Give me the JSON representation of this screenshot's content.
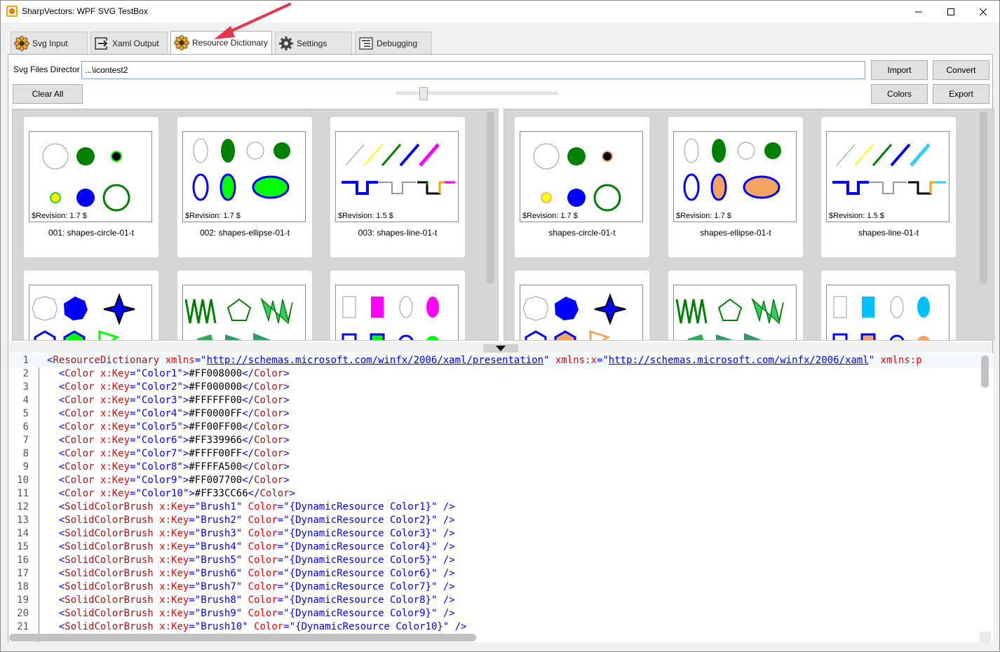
{
  "window": {
    "title": "SharpVectors: WPF SVG TestBox"
  },
  "tabs": [
    {
      "label": "Svg Input",
      "icon": "flower-icon"
    },
    {
      "label": "Xaml Output",
      "icon": "export-arrow-icon"
    },
    {
      "label": "Resource Dictionary",
      "icon": "flower-icon",
      "active": true
    },
    {
      "label": "Settings",
      "icon": "gear-icon"
    },
    {
      "label": "Debugging",
      "icon": "debug-list-icon"
    }
  ],
  "toolbar": {
    "dir_label": "Svg Files Director",
    "dir_value": "...\\icontest2",
    "import_label": "Import",
    "convert_label": "Convert",
    "clear_label": "Clear All",
    "colors_label": "Colors",
    "export_label": "Export"
  },
  "left_panel": {
    "cards": [
      {
        "revision": "$Revision: 1.7 $",
        "caption": "001: shapes-circle-01-t"
      },
      {
        "revision": "$Revision: 1.7 $",
        "caption": "002: shapes-ellipse-01-t"
      },
      {
        "revision": "$Revision: 1.5 $",
        "caption": "003: shapes-line-01-t"
      }
    ]
  },
  "right_panel": {
    "cards": [
      {
        "revision": "$Revision: 1.7 $",
        "caption": "shapes-circle-01-t"
      },
      {
        "revision": "$Revision: 1.7 $",
        "caption": "shapes-ellipse-01-t"
      },
      {
        "revision": "$Revision: 1.5 $",
        "caption": "shapes-line-01-t"
      }
    ]
  },
  "colors": {
    "accent": "#0078d7",
    "arrow": "#e8354f",
    "xml_tag": "#a31515",
    "xml_attr": "#ff0000",
    "xml_value": "#0000ff"
  },
  "editor": {
    "line_numbers": [
      "1",
      "2",
      "3",
      "4",
      "5",
      "6",
      "7",
      "8",
      "9",
      "10",
      "11",
      "12",
      "13",
      "14",
      "15",
      "16",
      "17",
      "18",
      "19",
      "20",
      "21"
    ],
    "root": {
      "tag": "ResourceDictionary",
      "attr1": "xmlns",
      "val1": "http://schemas.microsoft.com/winfx/2006/xaml/presentation",
      "attr2": "xmlns:x",
      "val2": "http://schemas.microsoft.com/winfx/2006/xaml",
      "attr3": "xmlns:p"
    },
    "colors": [
      {
        "key": "Color1",
        "value": "#FF008000"
      },
      {
        "key": "Color2",
        "value": "#FF000000"
      },
      {
        "key": "Color3",
        "value": "#FFFFFF00"
      },
      {
        "key": "Color4",
        "value": "#FF0000FF"
      },
      {
        "key": "Color5",
        "value": "#FF00FF00"
      },
      {
        "key": "Color6",
        "value": "#FF339966"
      },
      {
        "key": "Color7",
        "value": "#FFFF00FF"
      },
      {
        "key": "Color8",
        "value": "#FFFFA500"
      },
      {
        "key": "Color9",
        "value": "#FF007700"
      },
      {
        "key": "Color10",
        "value": "#FF33CC66"
      }
    ],
    "brushes": [
      {
        "key": "Brush1",
        "color": "{DynamicResource Color1}"
      },
      {
        "key": "Brush2",
        "color": "{DynamicResource Color2}"
      },
      {
        "key": "Brush3",
        "color": "{DynamicResource Color3}"
      },
      {
        "key": "Brush4",
        "color": "{DynamicResource Color4}"
      },
      {
        "key": "Brush5",
        "color": "{DynamicResource Color5}"
      },
      {
        "key": "Brush6",
        "color": "{DynamicResource Color6}"
      },
      {
        "key": "Brush7",
        "color": "{DynamicResource Color7}"
      },
      {
        "key": "Brush8",
        "color": "{DynamicResource Color8}"
      },
      {
        "key": "Brush9",
        "color": "{DynamicResource Color9}"
      },
      {
        "key": "Brush10",
        "color": "{DynamicResource Color10}"
      }
    ]
  }
}
